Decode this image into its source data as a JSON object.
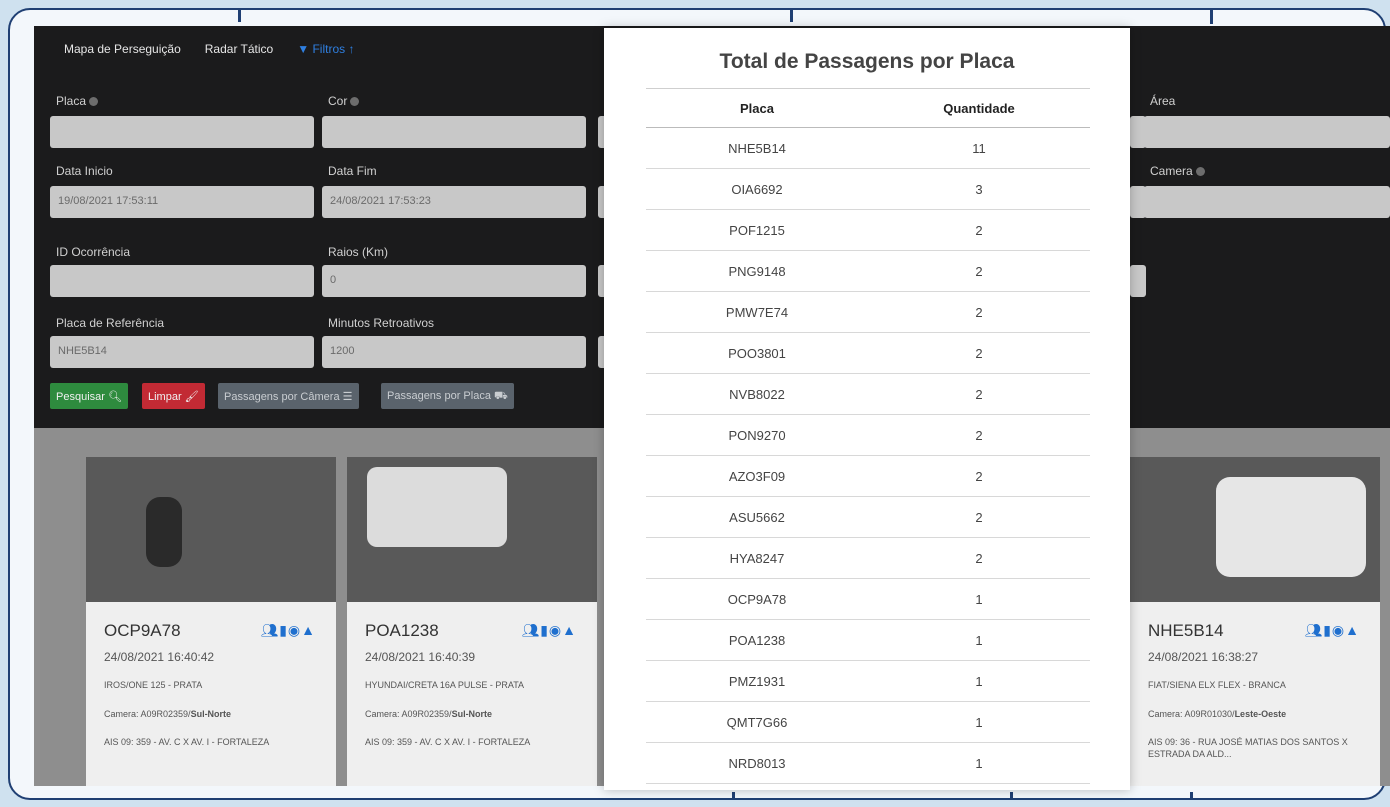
{
  "nav": {
    "items": [
      "Mapa de Perseguição",
      "Radar Tático"
    ],
    "filter_label": "Filtros"
  },
  "form": {
    "placa_label": "Placa",
    "cor_label": "Cor",
    "area_label": "Área",
    "data_inicio_label": "Data Inicio",
    "data_inicio_value": "19/08/2021 17:53:11",
    "data_fim_label": "Data Fim",
    "data_fim_value": "24/08/2021 17:53:23",
    "camera_label": "Camera",
    "id_ocorrencia_label": "ID Ocorrência",
    "raios_label": "Raios (Km)",
    "raios_value": "0",
    "placa_ref_label": "Placa de Referência",
    "placa_ref_value": "NHE5B14",
    "minutos_label": "Minutos Retroativos",
    "minutos_value": "1200"
  },
  "buttons": {
    "pesquisar": "Pesquisar",
    "limpar": "Limpar",
    "passagens_camera": "Passagens por Câmera",
    "passagens_placa": "Passagens por Placa"
  },
  "cards": [
    {
      "plate": "OCP9A78",
      "time": "24/08/2021 16:40:42",
      "model": "IROS/ONE 125 - PRATA",
      "camera": "Camera: A09R02359/",
      "direction": "Sul-Norte",
      "address": "AIS 09: 359 - AV. C X AV. I - FORTALEZA"
    },
    {
      "plate": "POA1238",
      "time": "24/08/2021 16:40:39",
      "model": "HYUNDAI/CRETA 16A PULSE - PRATA",
      "camera": "Camera: A09R02359/",
      "direction": "Sul-Norte",
      "address": "AIS 09: 359 - AV. C X AV. I - FORTALEZA"
    },
    {
      "plate": "NHE5B14",
      "time": "24/08/2021 16:38:27",
      "model": "FIAT/SIENA ELX FLEX - BRANCA",
      "camera": "Camera: A09R01030/",
      "direction": "Leste-Oeste",
      "address": "AIS 09: 36 - RUA JOSÉ MATIAS DOS SANTOS X ESTRADA DA ALD..."
    }
  ],
  "modal": {
    "title": "Total de Passagens por Placa",
    "columns": [
      "Placa",
      "Quantidade"
    ],
    "rows": [
      [
        "NHE5B14",
        "11"
      ],
      [
        "OIA6692",
        "3"
      ],
      [
        "POF1215",
        "2"
      ],
      [
        "PNG9148",
        "2"
      ],
      [
        "PMW7E74",
        "2"
      ],
      [
        "POO3801",
        "2"
      ],
      [
        "NVB8022",
        "2"
      ],
      [
        "PON9270",
        "2"
      ],
      [
        "AZO3F09",
        "2"
      ],
      [
        "ASU5662",
        "2"
      ],
      [
        "HYA8247",
        "2"
      ],
      [
        "OCP9A78",
        "1"
      ],
      [
        "POA1238",
        "1"
      ],
      [
        "PMZ1931",
        "1"
      ],
      [
        "QMT7G66",
        "1"
      ],
      [
        "NRD8013",
        "1"
      ]
    ]
  }
}
